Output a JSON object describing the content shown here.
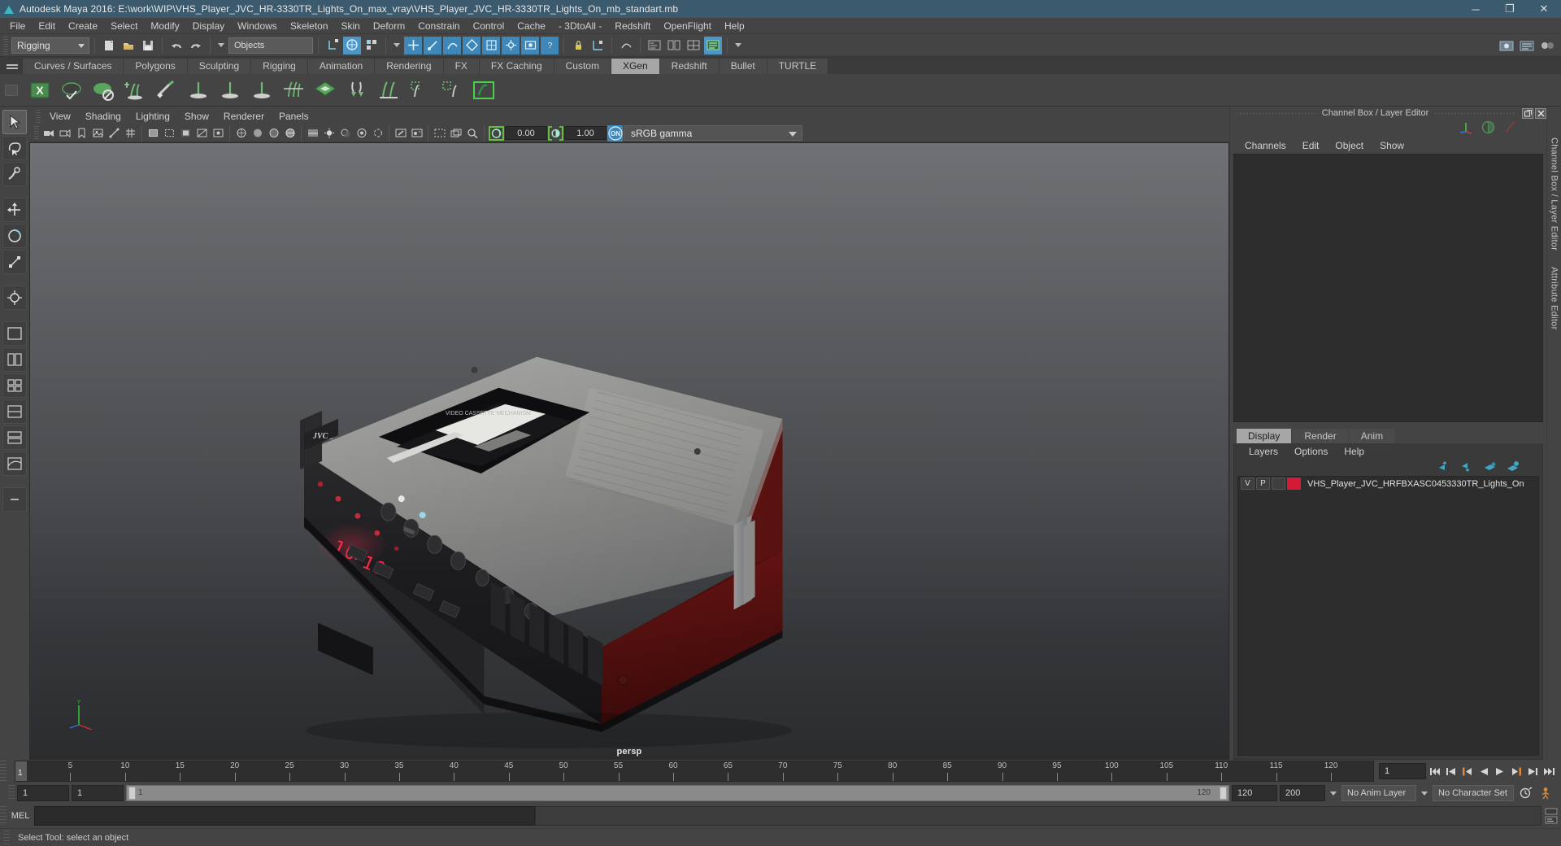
{
  "window": {
    "title": "Autodesk Maya 2016: E:\\work\\WIP\\VHS_Player_JVC_HR-3330TR_Lights_On_max_vray\\VHS_Player_JVC_HR-3330TR_Lights_On_mb_standart.mb",
    "minimize": "─",
    "maximize": "❐",
    "close": "✕"
  },
  "menubar": {
    "items": [
      {
        "label": "File"
      },
      {
        "label": "Edit"
      },
      {
        "label": "Create"
      },
      {
        "label": "Select"
      },
      {
        "label": "Modify"
      },
      {
        "label": "Display"
      },
      {
        "label": "Windows"
      },
      {
        "label": "Skeleton"
      },
      {
        "label": "Skin"
      },
      {
        "label": "Deform"
      },
      {
        "label": "Constrain"
      },
      {
        "label": "Control"
      },
      {
        "label": "Cache"
      },
      {
        "label": "- 3DtoAll -"
      },
      {
        "label": "Redshift"
      },
      {
        "label": "OpenFlight"
      },
      {
        "label": "Help"
      }
    ]
  },
  "statusline": {
    "menuset": "Rigging",
    "selection_mask": "Objects"
  },
  "shelf": {
    "tabs": [
      {
        "label": "Curves / Surfaces",
        "active": false
      },
      {
        "label": "Polygons",
        "active": false
      },
      {
        "label": "Sculpting",
        "active": false
      },
      {
        "label": "Rigging",
        "active": false
      },
      {
        "label": "Animation",
        "active": false
      },
      {
        "label": "Rendering",
        "active": false
      },
      {
        "label": "FX",
        "active": false
      },
      {
        "label": "FX Caching",
        "active": false
      },
      {
        "label": "Custom",
        "active": false
      },
      {
        "label": "XGen",
        "active": true
      },
      {
        "label": "Redshift",
        "active": false
      },
      {
        "label": "Bullet",
        "active": false
      },
      {
        "label": "TURTLE",
        "active": false
      }
    ]
  },
  "viewport": {
    "menus": [
      {
        "label": "View"
      },
      {
        "label": "Shading"
      },
      {
        "label": "Lighting"
      },
      {
        "label": "Show"
      },
      {
        "label": "Renderer"
      },
      {
        "label": "Panels"
      }
    ],
    "exposure": "0.00",
    "gamma": "1.00",
    "view_transform": "sRGB gamma",
    "camera_label": "persp"
  },
  "right_panel": {
    "title": "Channel Box / Layer Editor",
    "channel_menus": [
      {
        "label": "Channels"
      },
      {
        "label": "Edit"
      },
      {
        "label": "Object"
      },
      {
        "label": "Show"
      }
    ],
    "layer_tabs": [
      {
        "label": "Display",
        "active": true
      },
      {
        "label": "Render",
        "active": false
      },
      {
        "label": "Anim",
        "active": false
      }
    ],
    "layer_menus": [
      {
        "label": "Layers"
      },
      {
        "label": "Options"
      },
      {
        "label": "Help"
      }
    ],
    "layers": [
      {
        "visible": "V",
        "playback": "P",
        "state": "",
        "color": "#d31a36",
        "name": "VHS_Player_JVC_HRFBXASC0453330TR_Lights_On"
      }
    ],
    "vertical_tabs": [
      {
        "label": "Channel Box / Layer Editor"
      },
      {
        "label": "Attribute Editor"
      }
    ]
  },
  "timeline": {
    "current_frame": "1",
    "ticks": [
      {
        "value": "5",
        "frame": 5
      },
      {
        "value": "10",
        "frame": 10
      },
      {
        "value": "15",
        "frame": 15
      },
      {
        "value": "20",
        "frame": 20
      },
      {
        "value": "25",
        "frame": 25
      },
      {
        "value": "30",
        "frame": 30
      },
      {
        "value": "35",
        "frame": 35
      },
      {
        "value": "40",
        "frame": 40
      },
      {
        "value": "45",
        "frame": 45
      },
      {
        "value": "50",
        "frame": 50
      },
      {
        "value": "55",
        "frame": 55
      },
      {
        "value": "60",
        "frame": 60
      },
      {
        "value": "65",
        "frame": 65
      },
      {
        "value": "70",
        "frame": 70
      },
      {
        "value": "75",
        "frame": 75
      },
      {
        "value": "80",
        "frame": 80
      },
      {
        "value": "85",
        "frame": 85
      },
      {
        "value": "90",
        "frame": 90
      },
      {
        "value": "95",
        "frame": 95
      },
      {
        "value": "100",
        "frame": 100
      },
      {
        "value": "105",
        "frame": 105
      },
      {
        "value": "110",
        "frame": 110
      },
      {
        "value": "115",
        "frame": 115
      },
      {
        "value": "120",
        "frame": 120
      }
    ],
    "range_end_label": "120",
    "frame_field": "1",
    "range_start": "1",
    "range_start2": "1",
    "range_bar_start": "1",
    "range_bar_end": "120",
    "range_end": "120",
    "playback_end": "200",
    "anim_layer": "No Anim Layer",
    "character_set": "No Character Set"
  },
  "command_line": {
    "language": "MEL",
    "input": "",
    "output": ""
  },
  "statusbar": {
    "message": "Select Tool: select an object"
  },
  "colors": {
    "titlebar": "#3c5a6e",
    "accent_blue": "#3e87b8",
    "panel_bg": "#444444",
    "viewport_top": "#6f7174",
    "viewport_bottom": "#2a2c2e",
    "layer_color": "#d31a36",
    "playhead": "#e08030"
  }
}
